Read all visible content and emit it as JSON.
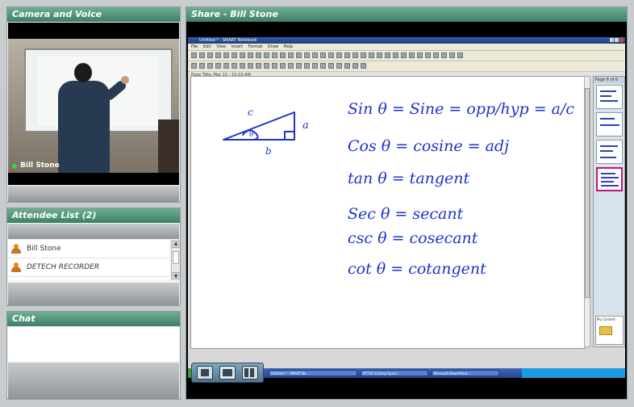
{
  "camera": {
    "title": "Camera and Voice",
    "presenter": "Bill Stone"
  },
  "attendees": {
    "title": "Attendee List (2)",
    "items": [
      {
        "name": "Bill Stone"
      },
      {
        "name": "DETECH RECORDER"
      }
    ]
  },
  "chat": {
    "title": "Chat"
  },
  "share": {
    "title": "Share - Bill Stone",
    "app_title": "Untitled * - SMART Notebook",
    "menus": [
      "File",
      "Edit",
      "View",
      "Insert",
      "Format",
      "Draw",
      "Help"
    ],
    "page_title": "Page Title: Mar 15 - 10:10 AM",
    "sorter_title": "Page 6 of 6",
    "gallery_label": "My Content",
    "triangle": {
      "hyp": "c",
      "opp": "a",
      "adj": "b",
      "angle": "θ"
    },
    "formulas": [
      "Sin θ = Sine = opp/hyp = a/c",
      "Cos θ = cosine = adj",
      "tan θ = tangent",
      "Sec θ = secant",
      "csc θ = cosecant",
      "cot θ = cotangent"
    ],
    "ink_color": "#1d33c9",
    "taskbar": [
      {
        "label": "Untitled * - SMART No..."
      },
      {
        "label": "RTTSE (Calling Span)..."
      },
      {
        "label": "Microsoft PowerPoint..."
      }
    ]
  },
  "colors": {
    "header": "#3d7f66",
    "ink": "#1d33c9"
  }
}
